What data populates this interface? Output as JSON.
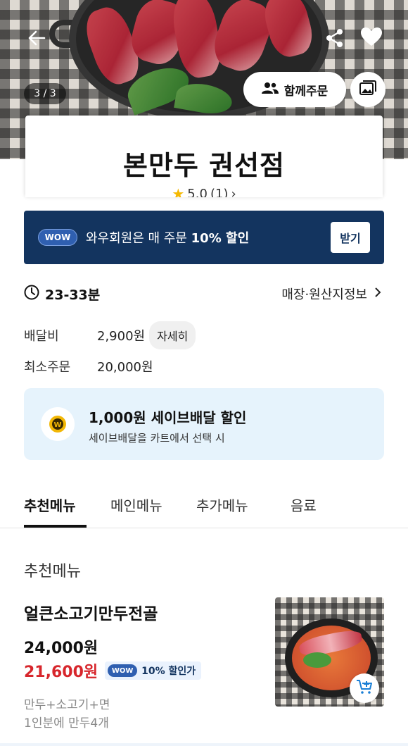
{
  "header": {
    "page_counter": "3 / 3",
    "group_order_label": "함께주문"
  },
  "store": {
    "name": "본만두 권선점",
    "rating": "5.0",
    "review_count": "(1)"
  },
  "wow_banner": {
    "pill": "WOW",
    "text_prefix": "와우회원은 매 주문 ",
    "text_bold": "10% 할인",
    "receive_label": "받기"
  },
  "delivery": {
    "time": "23-33분",
    "store_info_link": "매장·원산지정보",
    "fee_label": "배달비",
    "fee_value": "2,900원",
    "detail_button": "자세히",
    "min_order_label": "최소주문",
    "min_order_value": "20,000원"
  },
  "save_delivery": {
    "title": "1,000원 세이브배달 할인",
    "subtitle": "세이브배달을 카트에서 선택 시"
  },
  "tabs": [
    "추천메뉴",
    "메인메뉴",
    "추가메뉴",
    "음료"
  ],
  "section_title": "추천메뉴",
  "menu_item": {
    "name": "얼큰소고기만두전골",
    "price": "24,000원",
    "sale_price": "21,600원",
    "wow_pill": "WOW",
    "wow_discount": "10% 할인가",
    "desc_line1": "만두+소고기+면",
    "desc_line2": "1인분에 만두4개"
  },
  "colors": {
    "wow_navy": "#13345f",
    "sale_red": "#d7262c",
    "save_box_bg": "#e6f3fc"
  }
}
